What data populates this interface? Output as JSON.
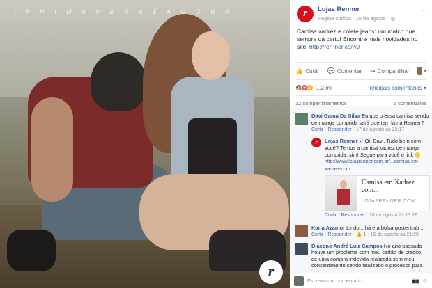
{
  "photo": {
    "banner": "/ P R I M A V E R A É A G O R A",
    "logo_letter": "r"
  },
  "post": {
    "page_logo_letter": "r",
    "page_name": "Lojas Renner",
    "meta_label": "Página curtida · 16 de agosto ·",
    "caption": "Camisa xadrez e colete jeans: um match que sempre dá certo! Encontre mais novidades no site:",
    "caption_link": "http://ren-ner.co/ivJ"
  },
  "actions": {
    "like": "Curtir",
    "comment": "Comentar",
    "share": "Compartilhar"
  },
  "stats": {
    "reactions_count": "1,2 mil",
    "sort_label": "Principais comentários",
    "shares": "12 compartilhamentos",
    "comments": "5 comentários"
  },
  "comments": [
    {
      "name": "Davi Gama Da Silva",
      "text": "Eu que o essa camisa sendo de manga comprida será que tem lá na Renner?",
      "like": "Curtir",
      "reply": "Responder",
      "time": "17 de agosto às 23:17"
    },
    {
      "name": "Karla Azamor",
      "text": "Lindo... há e a bolsa gostei tmb ...",
      "like": "Curtir",
      "reply": "Responder",
      "likes": "1",
      "time": "16 de agosto às 21:28"
    },
    {
      "name": "Diácono André Luiz Campos",
      "text": "No ano passado houve um problema com meu cartão de credito de uma compra indevida realizada sem meu consentimento sendo realizado o processo para junto a empresa Renner para reaver o reembolso do q eu tinha pago indevidamente por não ter sido eu"
    }
  ],
  "reply": {
    "avatar_letter": "r",
    "name": "Lojas Renner",
    "text": "Oi, Davi. Tudo bem com você? Temos a camisa xadrez de manga comprida, sim! Segue para você o link",
    "link": "http://www.lojasrenner.com.br/...camisa-em-xadrez-com...",
    "preview_title": "Camisa em Xadrez com...",
    "preview_domain": "LOJASRENNER.COM...",
    "like": "Curtir",
    "reply": "Responder",
    "time": "18 de agosto às 13:28"
  },
  "write": {
    "placeholder": "Escreva um comentário"
  },
  "colors": {
    "brand_red": "#d4111e",
    "link_blue": "#365899"
  }
}
